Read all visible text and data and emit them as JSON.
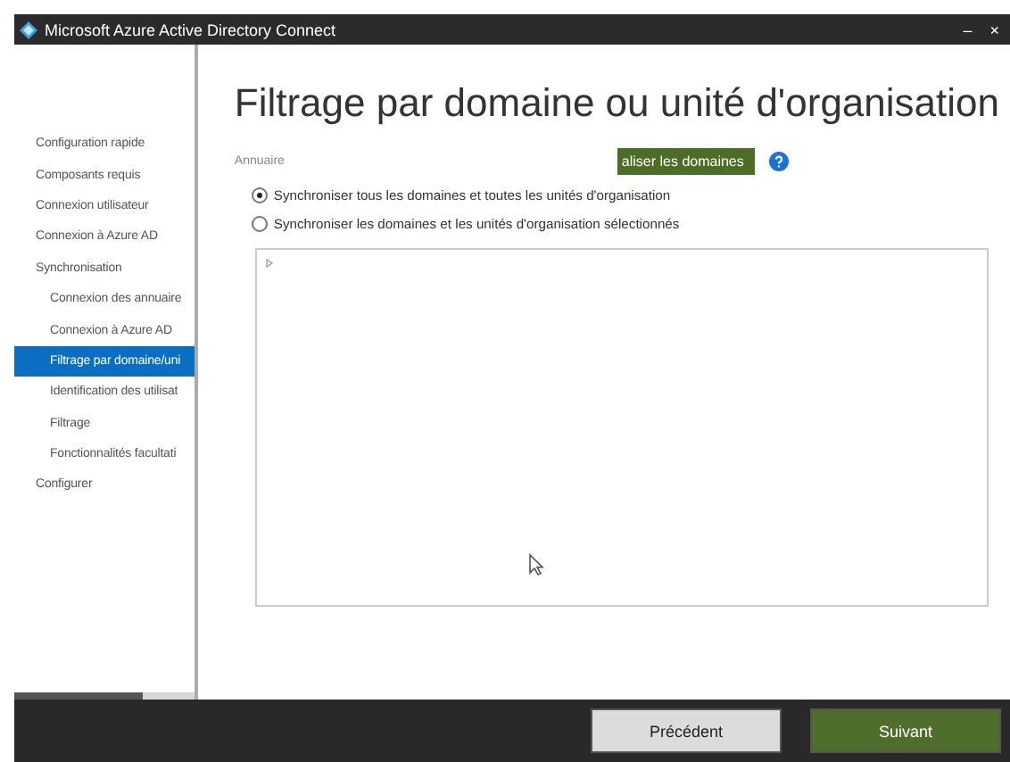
{
  "window": {
    "title": "Microsoft Azure Active Directory Connect",
    "controls": [
      "–",
      "×"
    ]
  },
  "sidebar": {
    "items": [
      {
        "label": "Configuration rapide",
        "selected": false
      },
      {
        "label": "Composants requis",
        "selected": false
      },
      {
        "label": "Connexion utilisateur",
        "selected": false
      },
      {
        "label": "Connexion à Azure AD",
        "selected": false
      },
      {
        "label": "Synchronisation",
        "selected": false,
        "children": [
          {
            "label": "Connexion des annuaire",
            "selected": false
          },
          {
            "label": "Connexion à Azure AD",
            "selected": false
          },
          {
            "label": "Filtrage par domaine/uni",
            "selected": true
          },
          {
            "label": "Identification des utilisat",
            "selected": false
          },
          {
            "label": "Filtrage",
            "selected": false
          },
          {
            "label": "Fonctionnalités facultati",
            "selected": false
          }
        ]
      },
      {
        "label": "Configurer",
        "selected": false
      }
    ]
  },
  "page": {
    "title": "Filtrage par domaine ou unité d'organisation",
    "directory_label": "Annuaire",
    "refresh_button": "aliser les domaines",
    "options": [
      {
        "label": "Synchroniser tous les domaines et toutes les unités d'organisation",
        "selected": true
      },
      {
        "label": "Synchroniser les domaines et les unités d'organisation sélectionnés",
        "selected": false
      }
    ]
  },
  "footer": {
    "buttons": [
      {
        "label": "Précédent",
        "kind": "secondary"
      },
      {
        "label": "Suivant",
        "kind": "primary"
      }
    ]
  }
}
